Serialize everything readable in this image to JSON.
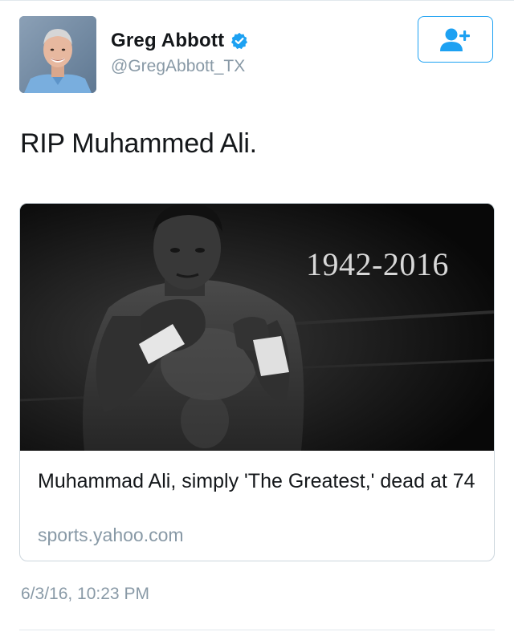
{
  "user": {
    "display_name": "Greg Abbott",
    "handle": "@GregAbbott_TX",
    "verified": true,
    "avatar_icon": "user-avatar-photo"
  },
  "follow_button": {
    "icon": "follow-user-plus-icon",
    "color": "#1da1f2"
  },
  "tweet": {
    "text": "RIP Muhammed Ali."
  },
  "card": {
    "image_caption": "1942-2016",
    "title": "Muhammad Ali, simply 'The Greatest,' dead at 74",
    "domain": "sports.yahoo.com"
  },
  "timestamp": "6/3/16, 10:23 PM",
  "colors": {
    "accent": "#1da1f2",
    "text": "#14171a",
    "secondary_text": "#8899a6",
    "border": "#ccd6dd"
  }
}
